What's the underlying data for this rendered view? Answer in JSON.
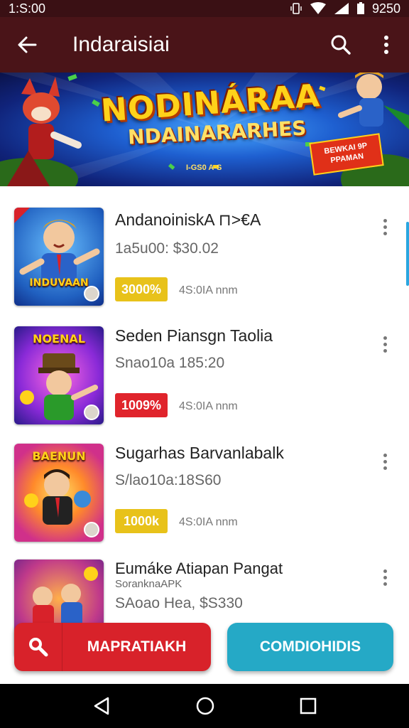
{
  "status_bar": {
    "time": "1:S:00",
    "right_text": "9250",
    "icons": [
      "vibrate-icon",
      "wifi-icon",
      "signal-icon",
      "battery-icon"
    ]
  },
  "app_bar": {
    "title": "Indaraisiai",
    "icons": [
      "back-arrow-icon",
      "search-icon",
      "more-vert-icon"
    ]
  },
  "banner": {
    "title": "NODINÁRAA",
    "subtitle": "NDAINARARHES",
    "small_text": "I-GS0 A-S",
    "badge_text": "BEWKAI 9P PPAMAN"
  },
  "items": [
    {
      "title": "AndanoiniskA ⊓>€A",
      "subtitle": "1a5u00: $30.02",
      "pill": "3000%",
      "pill_color": "#e8c21a",
      "meta": "4S:0IA nnm",
      "thumb_text": "INDUVAAN"
    },
    {
      "title": "Seden Piansgn Taolia",
      "subtitle": "Snao10a 185:20",
      "pill": "1009%",
      "pill_color": "#e0242c",
      "meta": "4S:0IA nnm",
      "thumb_text": "NOENAL"
    },
    {
      "title": "Sugarhas Barvanlabalk",
      "subtitle": "S/lao10a:18S60",
      "pill": "1000k",
      "pill_color": "#e8c21a",
      "meta": "4S:0IA nnm",
      "thumb_text": "BAENUN"
    },
    {
      "title": "Eumáke Atiapan Pangat",
      "subtitle_small": "SoranknaAPK",
      "subtitle": "SAoao Hea, $S330",
      "thumb_text": ""
    }
  ],
  "buttons": {
    "left": "MAPRATIAKH",
    "right": "COMDIOHIDIS"
  },
  "colors": {
    "app_bar": "#4a1418",
    "accent_red": "#d8222a",
    "accent_teal": "#25a9c6"
  }
}
